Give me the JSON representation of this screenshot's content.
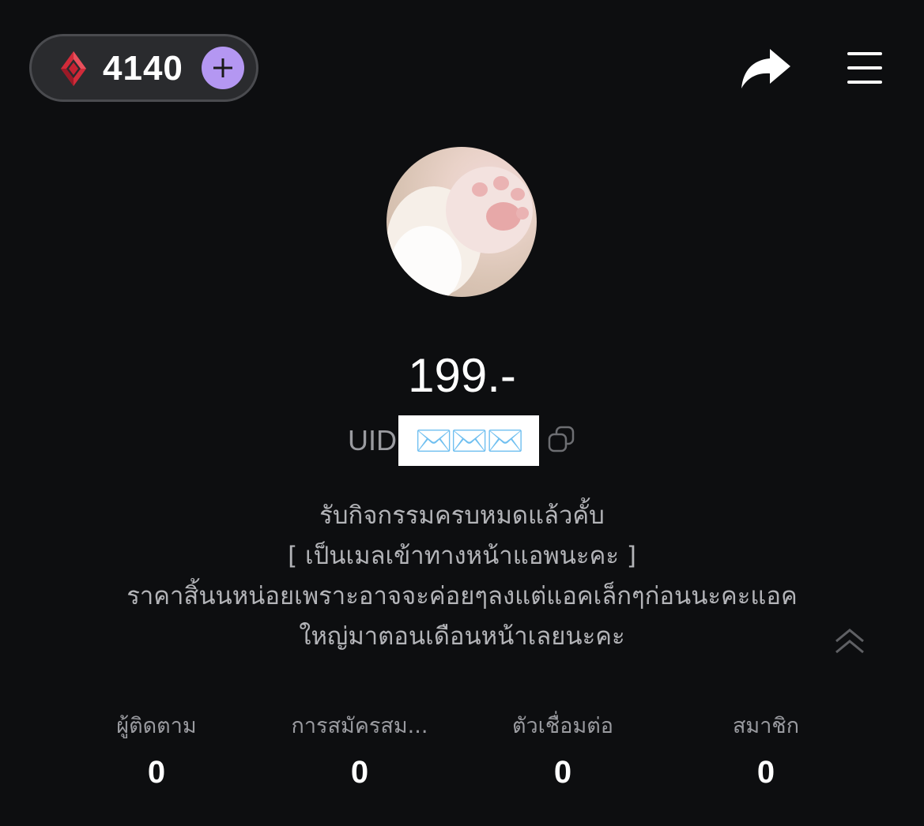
{
  "header": {
    "coin_balance": "4140",
    "icons": {
      "gem": "gem-icon",
      "add": "plus-icon",
      "share": "share-arrow-icon",
      "menu": "hamburger-menu-icon"
    },
    "colors": {
      "add_button": "#b497f2",
      "gem": "#d12b3a"
    }
  },
  "profile": {
    "name": "199.-",
    "uid_label": "UID",
    "uid_value": "✉️✉️✉️",
    "bio_lines": [
      "รับกิจกรรมครบหมดแล้วคั้บ",
      "[ เป็นเมลเข้าทางหน้าแอพนะคะ ]",
      "ราคาสิ้นนหน่อยเพราะอาจจะค่อยๆลงแต่แอคเล็กๆก่อนนะคะแอค",
      "ใหญ่มาตอนเดือนหน้าเลยนะคะ"
    ]
  },
  "stats": [
    {
      "label": "ผู้ติดตาม",
      "value": "0"
    },
    {
      "label": "การสมัครสม...",
      "value": "0"
    },
    {
      "label": "ตัวเชื่อมต่อ",
      "value": "0"
    },
    {
      "label": "สมาชิก",
      "value": "0"
    }
  ]
}
